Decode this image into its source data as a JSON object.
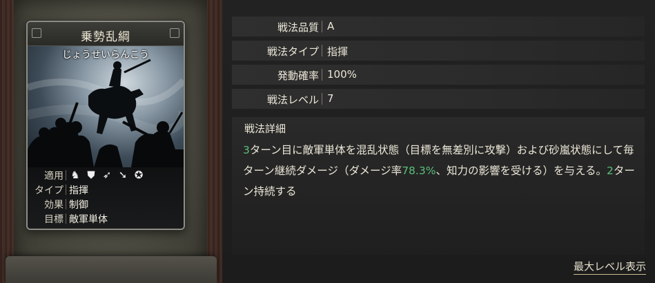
{
  "card": {
    "name": "乗勢乱綱",
    "reading": "じょうせいらんこう",
    "rows": [
      {
        "label": "適用",
        "value": ""
      },
      {
        "label": "タイプ",
        "value": "指揮"
      },
      {
        "label": "効果",
        "value": "制御"
      },
      {
        "label": "目標",
        "value": "敵軍単体"
      }
    ],
    "troop_icons": [
      "cavalry-icon",
      "shield-icon",
      "bow-icon",
      "spear-icon",
      "chariot-wheel-icon"
    ]
  },
  "details": {
    "rows": [
      {
        "label": "戦法品質",
        "value": "A"
      },
      {
        "label": "戦法タイプ",
        "value": "指揮"
      },
      {
        "label": "発動確率",
        "value": "100%"
      },
      {
        "label": "戦法レベル",
        "value": "7"
      }
    ],
    "detail_title": "戦法詳細",
    "detail_parts": [
      {
        "text": "3",
        "highlight": true
      },
      {
        "text": "ターン目に敵軍単体を混乱状態（目標を無差別に攻撃）および砂嵐状態にして毎ターン継続ダメージ（ダメージ率",
        "highlight": false
      },
      {
        "text": "78.3%",
        "highlight": true
      },
      {
        "text": "、知力の影響を受ける）を与える。",
        "highlight": false
      },
      {
        "text": "2",
        "highlight": true
      },
      {
        "text": "ターン持続する",
        "highlight": false
      }
    ],
    "max_level_link": "最大レベル表示"
  },
  "colors": {
    "highlight": "#59c07a",
    "text": "#ece7d8"
  }
}
